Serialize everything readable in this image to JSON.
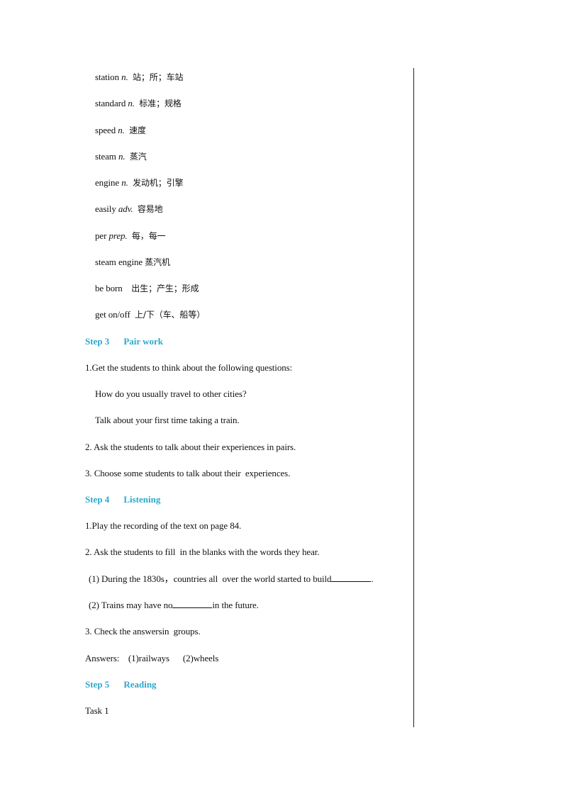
{
  "accent_color": "#2ea8cb",
  "vocabulary": [
    {
      "word": "station",
      "pos": "n.",
      "meaning": "站；所；车站"
    },
    {
      "word": "standard",
      "pos": "n.",
      "meaning": "标准；规格"
    },
    {
      "word": "speed",
      "pos": "n.",
      "meaning": "速度"
    },
    {
      "word": "steam",
      "pos": "n.",
      "meaning": "蒸汽"
    },
    {
      "word": "engine",
      "pos": "n.",
      "meaning": "发动机；引擎"
    },
    {
      "word": "easily",
      "pos": "adv.",
      "meaning": "容易地"
    },
    {
      "word": "per",
      "pos": "prep.",
      "meaning": "每，每一"
    },
    {
      "word": "steam engine",
      "pos": "",
      "meaning": "蒸汽机"
    },
    {
      "word": "be born",
      "pos": "",
      "meaning": "出生；产生；形成"
    },
    {
      "word": "get on/off",
      "pos": "",
      "meaning": "上/下（车、船等）"
    }
  ],
  "step3": {
    "number": "Step 3",
    "title": "Pair work",
    "item1": "1.Get the students to think about the following questions:",
    "q1": "How do you usually travel to other cities?",
    "q2": "Talk about your first time taking a train.",
    "item2": "2. Ask the students to talk about their experiences in pairs.",
    "item3": "3. Choose some students to talk about their  experiences."
  },
  "step4": {
    "number": "Step 4",
    "title": "Listening",
    "item1": "1.Play the recording of the text on page 84.",
    "item2": "2. Ask the students to fill  in the blanks with the words they hear.",
    "blank1_before": "(1) During the 1830s，countries all  over the world started to build",
    "blank1_after": ".",
    "blank2_before": "(2) Trains may have no",
    "blank2_after": "in the future.",
    "item3": "3. Check the answersin  groups.",
    "answers": "Answers:    (1)railways      (2)wheels"
  },
  "step5": {
    "number": "Step 5",
    "title": "Reading",
    "task": "Task 1"
  }
}
